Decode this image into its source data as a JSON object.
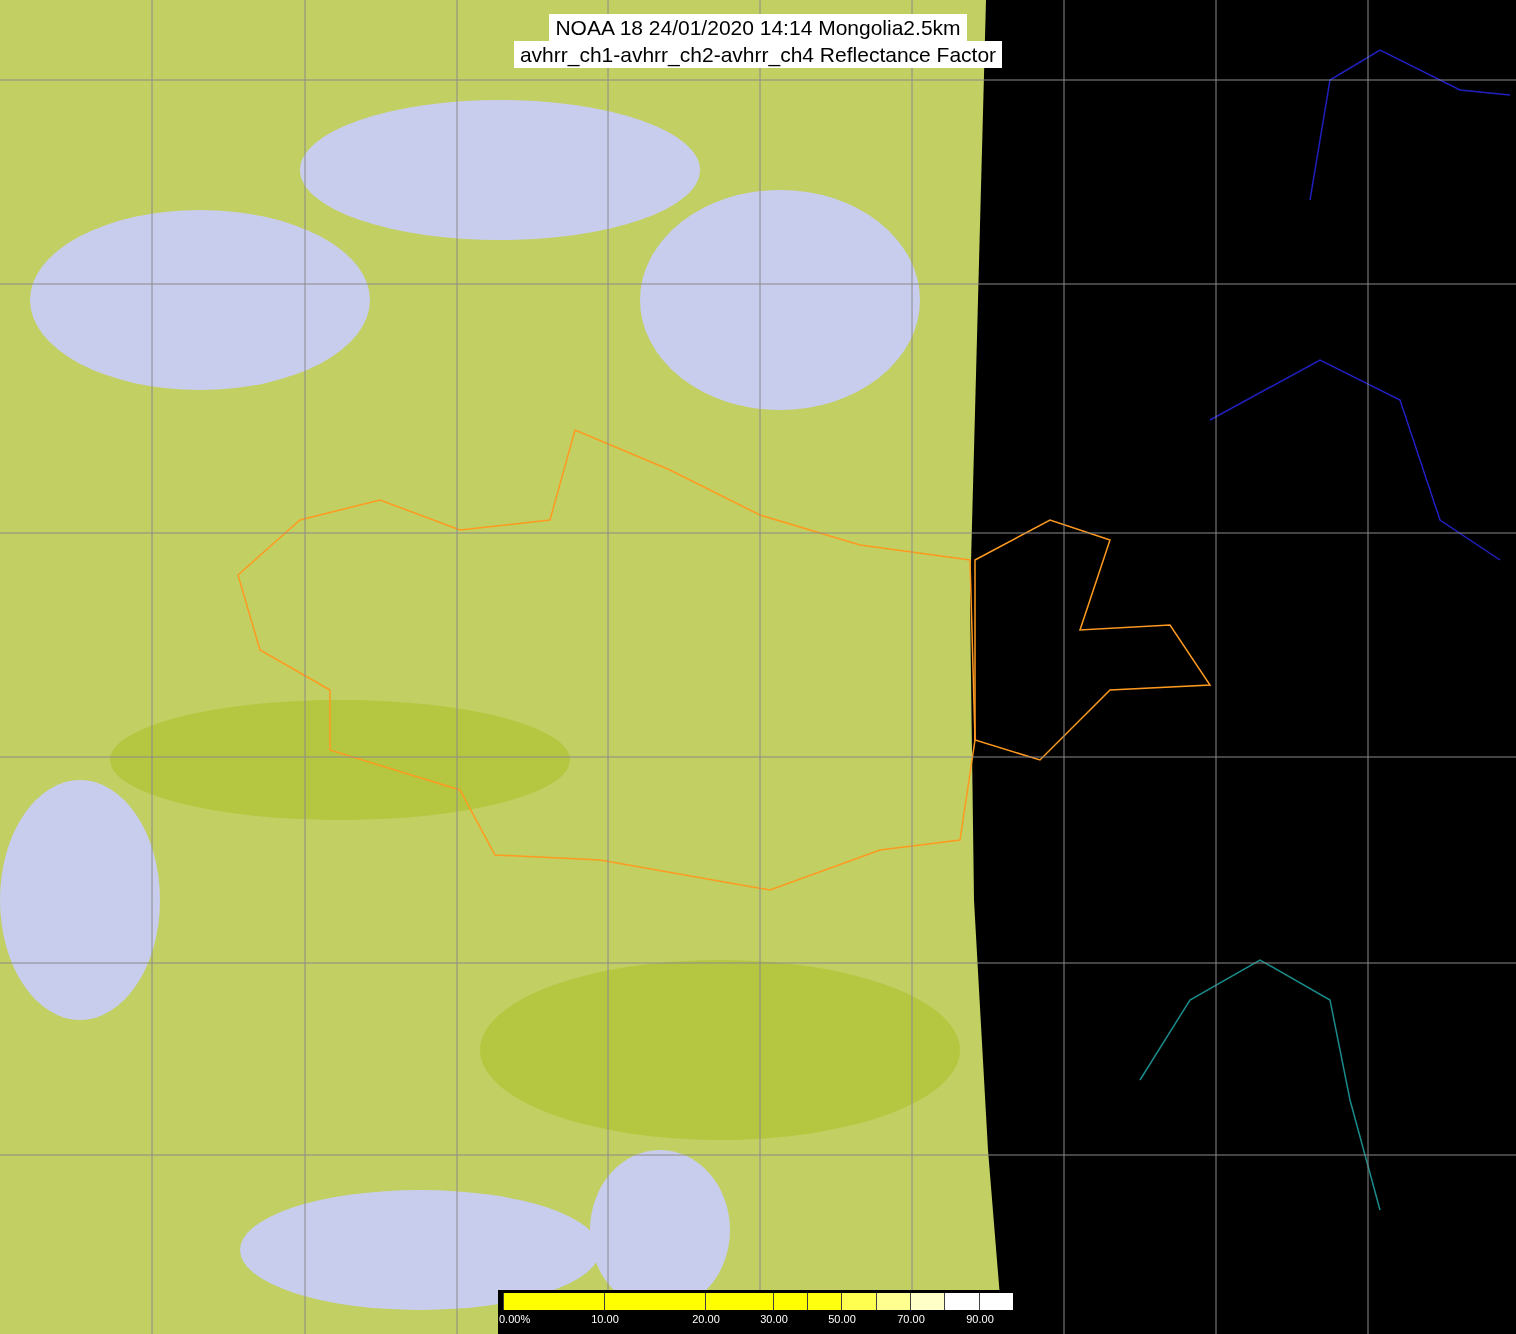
{
  "title": {
    "lines": [
      "NOAA 18 24/01/2020 14:14 Mongolia2.5km",
      "avhrr_ch1-avhrr_ch2-avhrr_ch4 Reflectance Factor"
    ]
  },
  "colorbar": {
    "segments": [
      {
        "color": "#ffff00",
        "label": "0.00%"
      },
      {
        "color": "#ffff00",
        "label": "10.00"
      },
      {
        "color": "#ffff00",
        "label": "20.00"
      },
      {
        "color": "#ffff00",
        "label": "30.00"
      },
      {
        "color": "#ffff10"
      },
      {
        "color": "#ffff50",
        "label": "50.00"
      },
      {
        "color": "#ffff90"
      },
      {
        "color": "#ffffc8",
        "label": "70.00"
      },
      {
        "color": "#ffffff"
      },
      {
        "color": "#ffffff",
        "label": "90.00"
      }
    ]
  }
}
